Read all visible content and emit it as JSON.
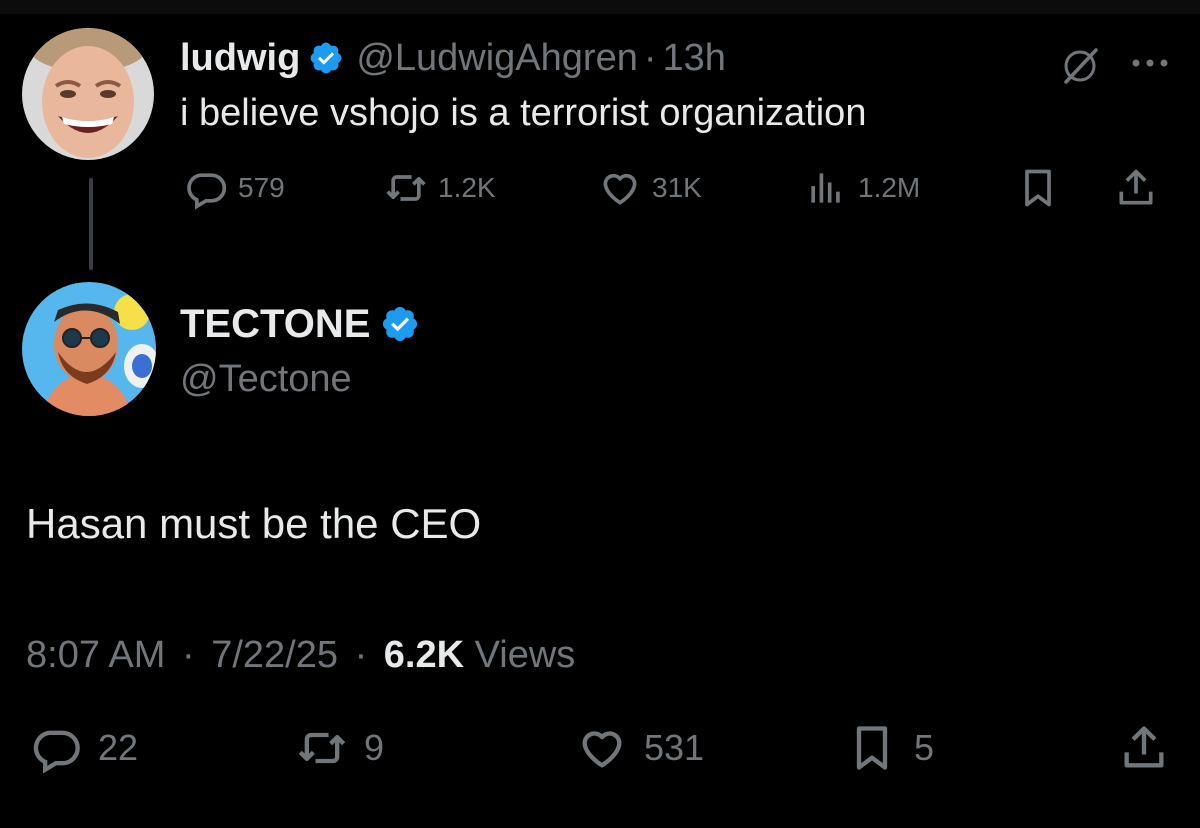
{
  "colors": {
    "background": "#000000",
    "text_primary": "#e7e9ea",
    "text_secondary": "#71767b",
    "verified_blue": "#1d9bf0"
  },
  "parent_tweet": {
    "author_name": "ludwig",
    "handle": "@LudwigAhgren",
    "separator": "·",
    "time": "13h",
    "text": "i believe vshojo is a terrorist organization",
    "icons": [
      "verified-badge-icon",
      "grok-icon",
      "more-icon"
    ],
    "actions": {
      "reply_count": "579",
      "repost_count": "1.2K",
      "like_count": "31K",
      "view_count": "1.2M"
    }
  },
  "main_tweet": {
    "author_name": "TECTONE",
    "handle": "@Tectone",
    "text": "Hasan must be the CEO",
    "timestamp_time": "8:07 AM",
    "separator": "·",
    "timestamp_date": "7/22/25",
    "views_count": "6.2K",
    "views_label": "Views",
    "actions": {
      "reply_count": "22",
      "repost_count": "9",
      "like_count": "531",
      "bookmark_count": "5"
    }
  }
}
